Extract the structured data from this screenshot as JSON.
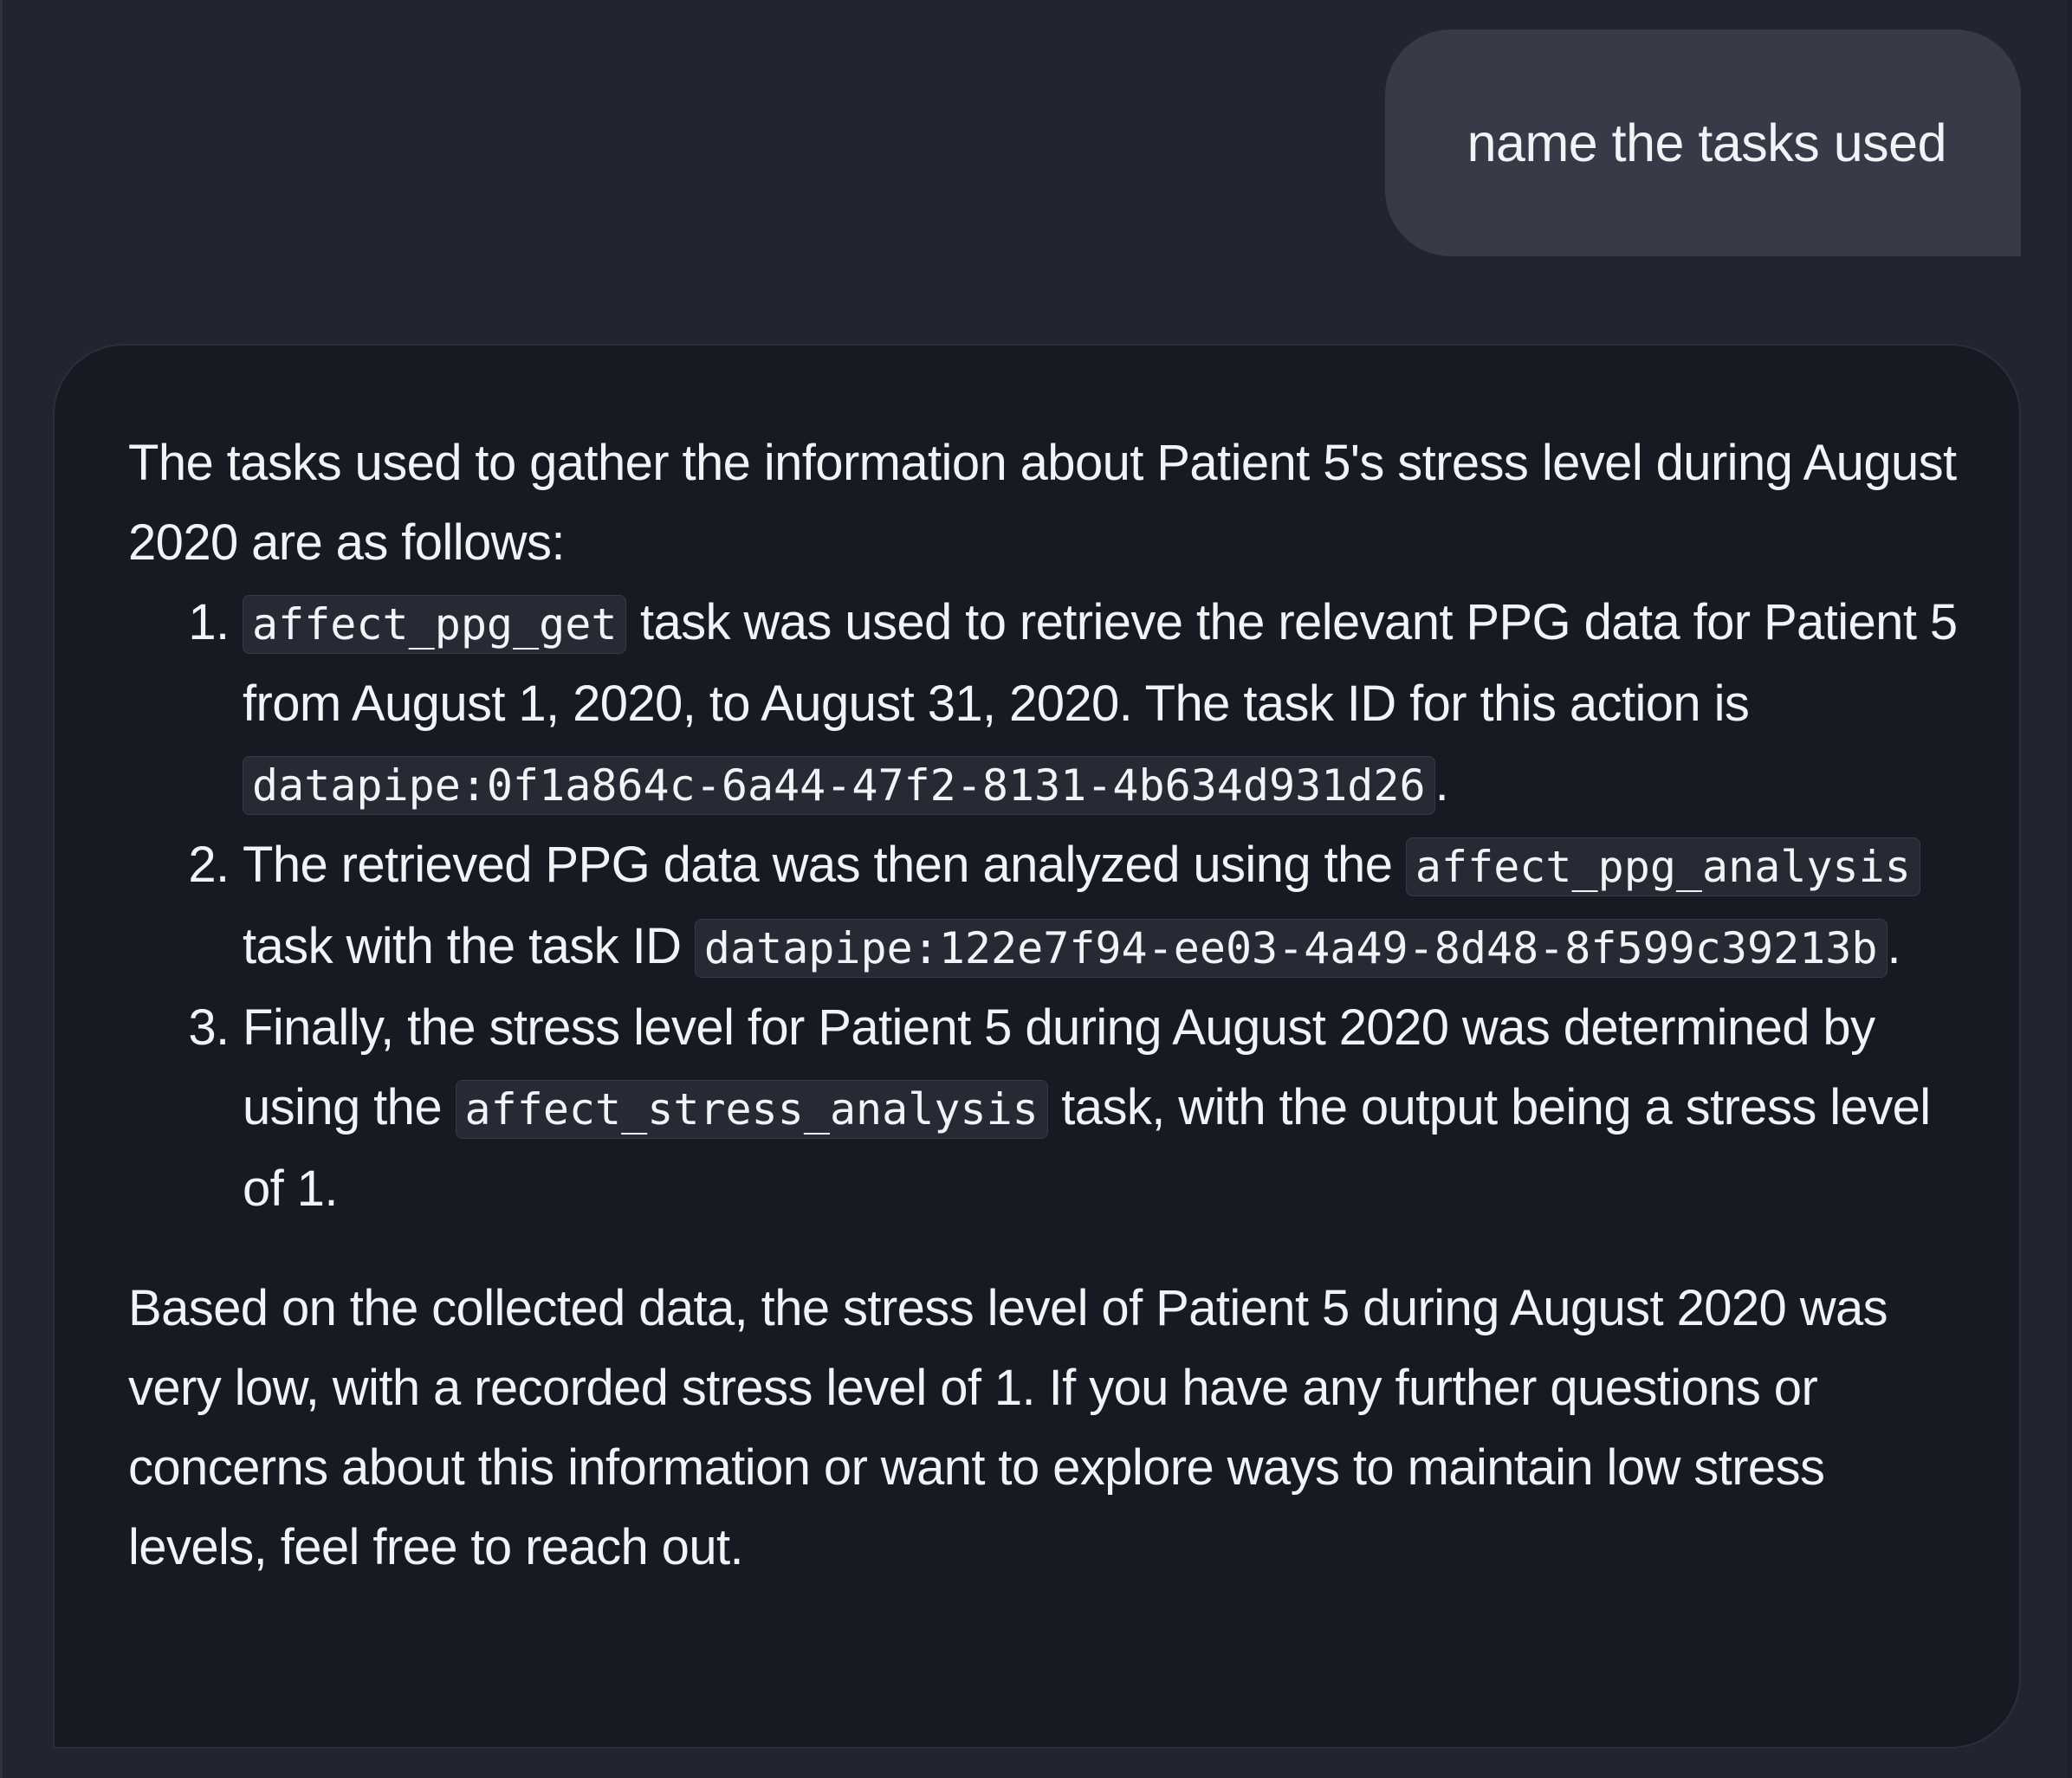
{
  "user_message": {
    "text": "name the tasks used"
  },
  "assistant_message": {
    "intro": "The tasks used to gather the information about Patient 5's stress level during August 2020 are as follows:",
    "items": [
      {
        "code_1": "affect_ppg_get",
        "text_1": " task was used to retrieve the relevant PPG data for Patient 5 from August 1, 2020, to August 31, 2020. The task ID for this action is ",
        "code_2": "datapipe:0f1a864c-6a44-47f2-8131-4b634d931d26",
        "text_2": "."
      },
      {
        "text_0": "The retrieved PPG data was then analyzed using the ",
        "code_1": "affect_ppg_analysis",
        "text_1": " task with the task ID ",
        "code_2": "datapipe:122e7f94-ee03-4a49-8d48-8f599c39213b",
        "text_2": "."
      },
      {
        "text_0": "Finally, the stress level for Patient 5 during August 2020 was determined by using the ",
        "code_1": "affect_stress_analysis",
        "text_1": " task, with the output being a stress level of 1."
      }
    ],
    "conclusion": "Based on the collected data, the stress level of Patient 5 during August 2020 was very low, with a recorded stress level of 1. If you have any further questions or concerns about this information or want to explore ways to maintain low stress levels, feel free to reach out."
  }
}
